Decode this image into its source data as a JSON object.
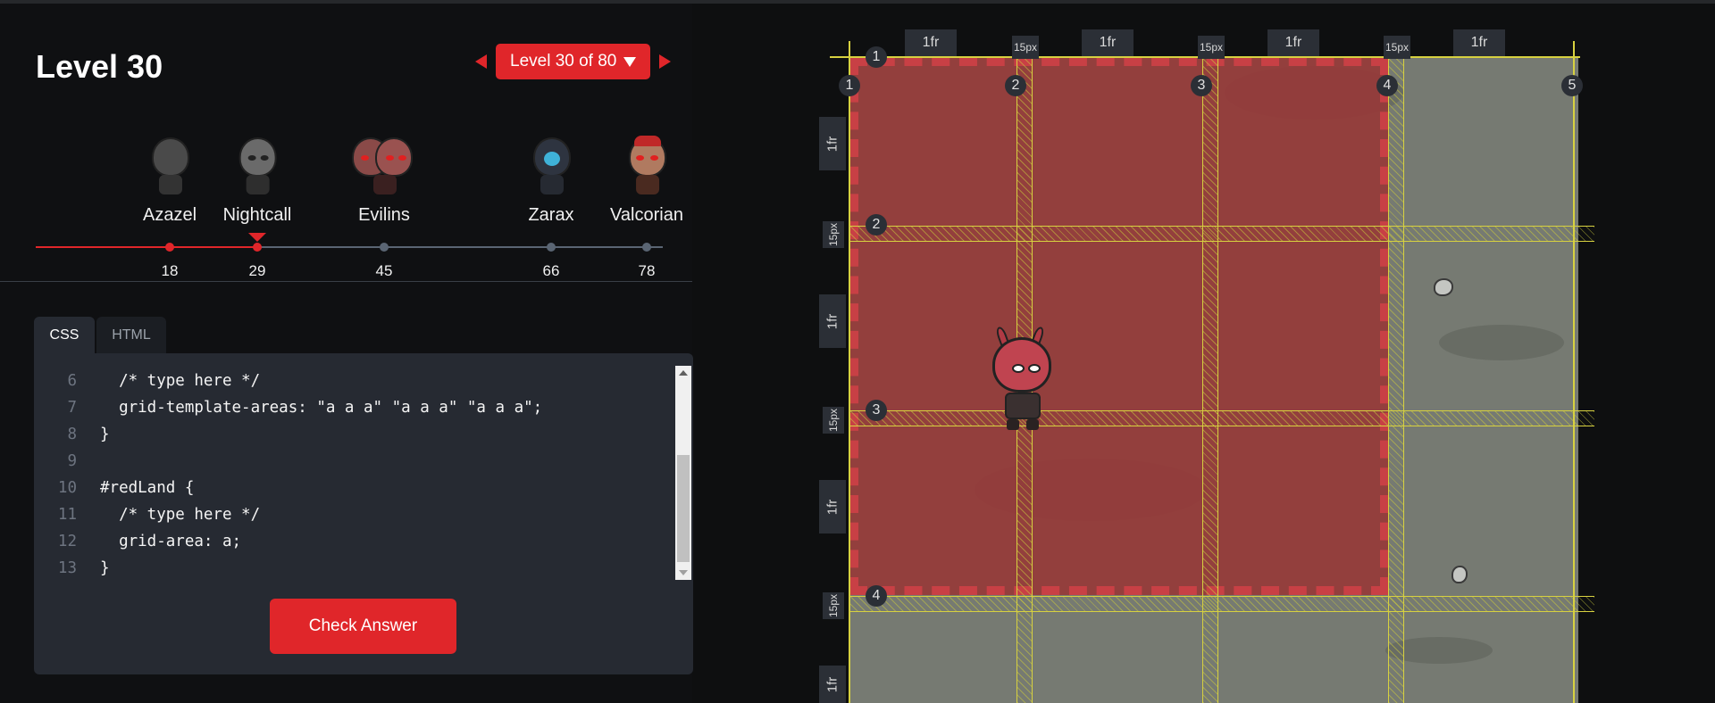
{
  "header": {
    "title": "Level 30",
    "level_selector": "Level 30 of 80"
  },
  "characters": [
    {
      "name": "Azazel",
      "level": "18",
      "state": "past"
    },
    {
      "name": "Nightcall",
      "level": "29",
      "state": "current"
    },
    {
      "name": "Evilins",
      "level": "45",
      "state": "future"
    },
    {
      "name": "Zarax",
      "level": "66",
      "state": "future"
    },
    {
      "name": "Valcorian",
      "level": "78",
      "state": "future"
    }
  ],
  "editor": {
    "tabs": [
      {
        "label": "CSS",
        "active": true
      },
      {
        "label": "HTML",
        "active": false
      }
    ],
    "lines": [
      {
        "n": "6",
        "text": "  /* type here */"
      },
      {
        "n": "7",
        "text": "  grid-template-areas: \"a a a\" \"a a a\" \"a a a\";"
      },
      {
        "n": "8",
        "text": "}"
      },
      {
        "n": "9",
        "text": ""
      },
      {
        "n": "10",
        "text": "#redLand {"
      },
      {
        "n": "11",
        "text": "  /* type here */"
      },
      {
        "n": "12",
        "text": "  grid-area: a;"
      },
      {
        "n": "13",
        "text": "}"
      }
    ],
    "check_button": "Check Answer"
  },
  "board": {
    "col_tracks": [
      "1fr",
      "15px",
      "1fr",
      "15px",
      "1fr",
      "15px",
      "1fr"
    ],
    "row_tracks": [
      "1fr",
      "15px",
      "1fr",
      "15px",
      "1fr",
      "15px",
      "1fr"
    ],
    "col_line_numbers": [
      "1",
      "2",
      "3",
      "4",
      "5"
    ],
    "row_line_numbers": [
      "1",
      "2",
      "3",
      "4"
    ],
    "colors": {
      "red_land": "#963a38",
      "gap_hatch": "#d7d140",
      "ground": "#767a72",
      "accent": "#e0262a"
    }
  }
}
